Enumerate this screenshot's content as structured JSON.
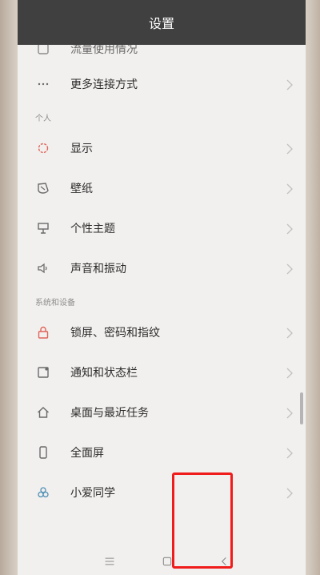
{
  "header": {
    "title": "设置"
  },
  "list": {
    "partial_item": {
      "label": "流量使用情况",
      "icon": "data-usage-icon"
    },
    "connection_item": {
      "label": "更多连接方式",
      "icon": "more-dots-icon"
    },
    "sections": [
      {
        "title": "个人",
        "items": [
          {
            "label": "显示",
            "icon": "sun-icon"
          },
          {
            "label": "壁纸",
            "icon": "wallpaper-icon"
          },
          {
            "label": "个性主题",
            "icon": "theme-icon"
          },
          {
            "label": "声音和振动",
            "icon": "speaker-icon"
          }
        ]
      },
      {
        "title": "系统和设备",
        "items": [
          {
            "label": "锁屏、密码和指纹",
            "icon": "lock-icon"
          },
          {
            "label": "通知和状态栏",
            "icon": "notification-icon"
          },
          {
            "label": "桌面与最近任务",
            "icon": "home-icon"
          },
          {
            "label": "全面屏",
            "icon": "phone-icon"
          },
          {
            "label": "小爱同学",
            "icon": "assistant-icon"
          }
        ]
      }
    ]
  },
  "navbar": {
    "menu_icon": "menu-icon",
    "home_icon": "home-square-icon",
    "back_icon": "back-chevron-icon"
  },
  "colors": {
    "titlebar": "#404040",
    "accent_red": "#e0635a",
    "highlight_box": "#f01c1c"
  }
}
